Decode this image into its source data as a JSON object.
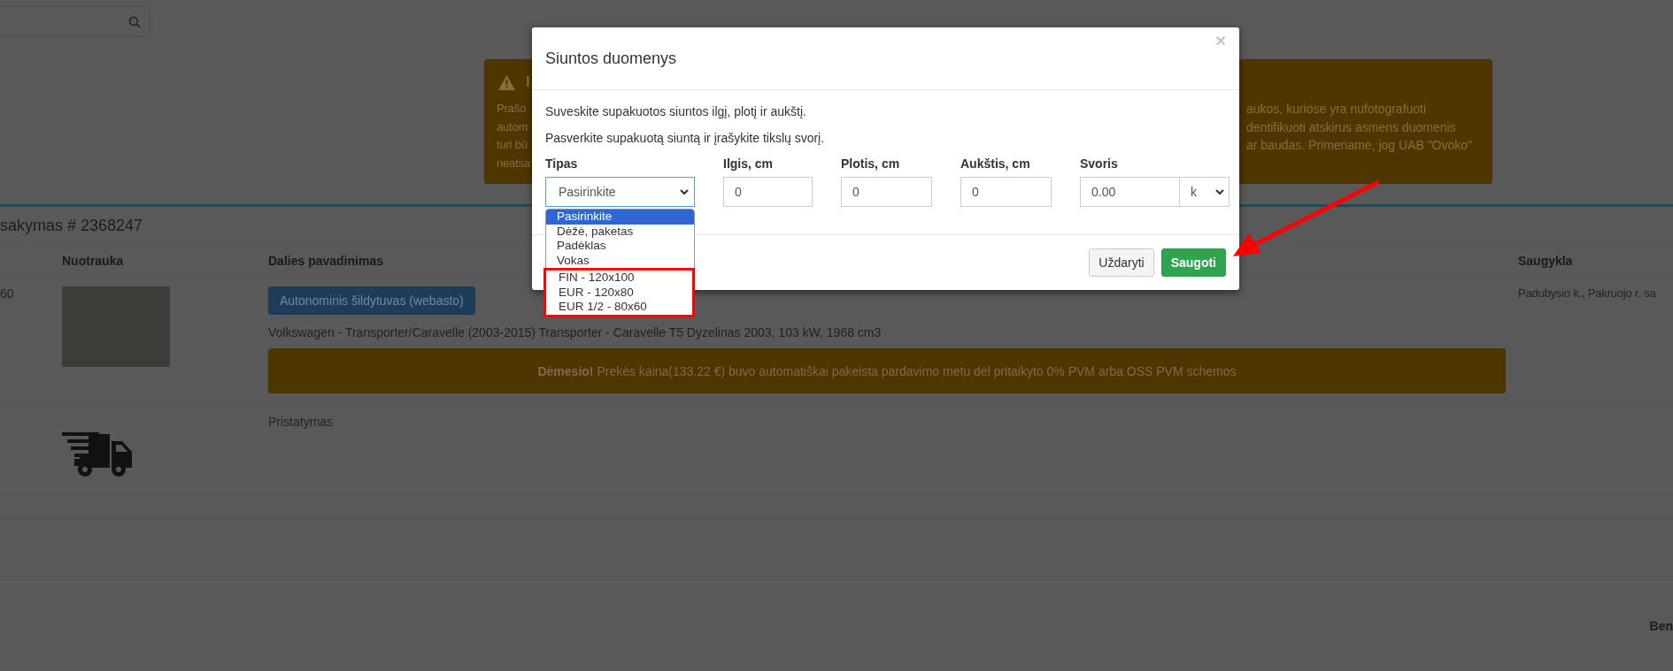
{
  "notice": {
    "title": "I",
    "left_lines": [
      "Prašo",
      "autom",
      "turi bū",
      "neatsa"
    ],
    "right_lines": [
      "aukos, kuriose yra nufotografuoti",
      "dentifikuoti atskirus asmens duomenis",
      "ar baudas. Primename, jog UAB \"Ovoko\""
    ]
  },
  "order": {
    "title": "sakymas # 2368247",
    "columns": [
      "Nuotrauka",
      "Dalies pavadinimas",
      "Saugykla"
    ],
    "rows": [
      {
        "kind": "part",
        "column_1": "60",
        "part_button": "Autonominis šildytuvas (webasto)",
        "vehicle": "Volkswagen - Transporter/Caravelle (2003-2015) Transporter - Caravelle T5 Dyzelinas 2003, 103 kW, 1968 cm3",
        "alert": "**Dėmesio!** Prekės kaina(133.22 €) buvo automatiškai pakeista pardavimo metu dėl pritaikyto 0% PVM arba OSS PVM schemos",
        "storage": "Padubysio k., Pakruojo r. sa"
      },
      {
        "kind": "delivery",
        "label": "Pristatymas"
      }
    ],
    "footer": "Ben"
  },
  "modal": {
    "title": "Siuntos duomenys",
    "close": "×",
    "instructions": [
      "Suveskite supakuotos siuntos ilgį, plotį ir aukštį.",
      "Pasverkite supakuotą siuntą ir įrašykite tikslų svorį."
    ],
    "fields": [
      {
        "kind": "select",
        "label": "Tipas",
        "value": "Pasirinkite",
        "open": true
      },
      {
        "kind": "input",
        "label": "Ilgis, cm",
        "value": "0"
      },
      {
        "kind": "input",
        "label": "Plotis, cm",
        "value": "0"
      },
      {
        "kind": "input",
        "label": "Aukštis, cm",
        "value": "0"
      },
      {
        "kind": "unit",
        "label": "Svoris",
        "value": "0.00",
        "unit": "k"
      }
    ],
    "options": [
      {
        "label": "Pasirinkite",
        "selected": true,
        "highlighted": false
      },
      {
        "label": "Dėžė, paketas",
        "selected": false,
        "highlighted": false
      },
      {
        "label": "Padėklas",
        "selected": false,
        "highlighted": false
      },
      {
        "label": "Vokas",
        "selected": false,
        "highlighted": false
      },
      {
        "label": "FIN - 120x100",
        "selected": false,
        "highlighted": true
      },
      {
        "label": "EUR - 120x80",
        "selected": false,
        "highlighted": true
      },
      {
        "label": "EUR 1/2 - 80x60",
        "selected": false,
        "highlighted": true
      }
    ],
    "buttons": [
      {
        "kind": "default",
        "label": "Uždaryti"
      },
      {
        "kind": "primary",
        "label": "Saugoti"
      }
    ]
  }
}
